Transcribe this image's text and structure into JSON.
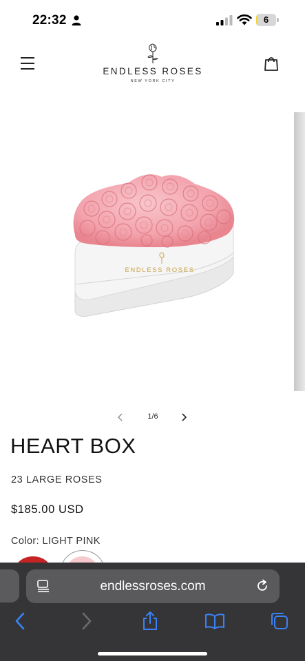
{
  "status_bar": {
    "time": "22:32",
    "battery_level": "6",
    "battery_fraction": 0.06,
    "battery_color": "#f2d43a"
  },
  "header": {
    "brand_name": "ENDLESS ROSES",
    "brand_location": "NEW YORK CITY",
    "menu_icon": "hamburger-icon",
    "cart_icon": "shopping-bag-icon"
  },
  "gallery": {
    "image_box_label": "ENDLESS ROSES",
    "rose_color": "#f3a3ad",
    "slide_counter": "1/6"
  },
  "product": {
    "title": "HEART BOX",
    "subtitle": "23 LARGE ROSES",
    "price": "$185.00 USD",
    "color_label": "Color: LIGHT PINK",
    "swatches": [
      {
        "name": "RED",
        "color": "#c62424"
      },
      {
        "name": "LIGHT PINK",
        "color": "#f6c9cf",
        "selected": true
      }
    ]
  },
  "browser": {
    "url": "endlessroses.com",
    "toolbar": [
      "back-icon",
      "forward-icon",
      "share-icon",
      "bookmarks-icon",
      "tabs-icon"
    ],
    "accent": "#3b82f6"
  }
}
